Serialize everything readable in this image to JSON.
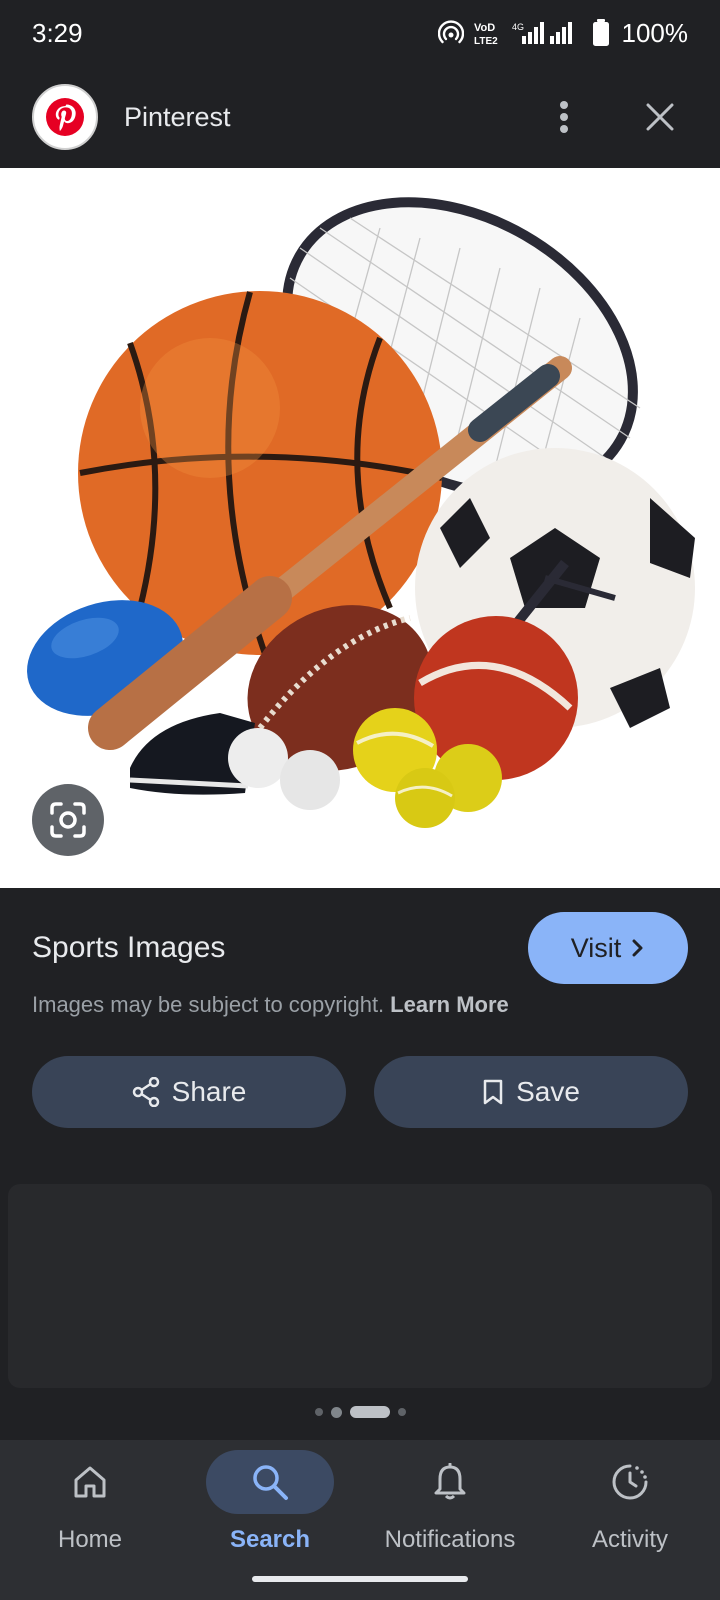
{
  "status_bar": {
    "time": "3:29",
    "network": "VoLTE 4G",
    "battery": "100%",
    "icons": [
      "hotspot-icon",
      "volte-icon",
      "signal-icon",
      "battery-icon"
    ]
  },
  "header": {
    "app_name": "Pinterest",
    "logo_icon": "pinterest-logo",
    "brand_color": "#e60023",
    "more_icon": "more-vertical-icon",
    "close_icon": "close-icon"
  },
  "image": {
    "subject": "sports-equipment-image",
    "lens_icon": "google-lens-icon"
  },
  "info": {
    "title": "Sports Images",
    "visit_label": "Visit",
    "copyright_text": "Images may be subject to copyright.",
    "learn_more_label": "Learn More",
    "share_label": "Share",
    "save_label": "Save"
  },
  "pager": {
    "count": 4,
    "active_index": 2
  },
  "bottom_nav": {
    "items": [
      {
        "label": "Home",
        "icon": "home-icon",
        "active": false
      },
      {
        "label": "Search",
        "icon": "search-icon",
        "active": true
      },
      {
        "label": "Notifications",
        "icon": "bell-icon",
        "active": false
      },
      {
        "label": "Activity",
        "icon": "activity-icon",
        "active": false
      }
    ]
  },
  "colors": {
    "background": "#202124",
    "accent": "#8ab4f8",
    "button_bg": "#394457",
    "nav_bg": "#2d2f33"
  }
}
